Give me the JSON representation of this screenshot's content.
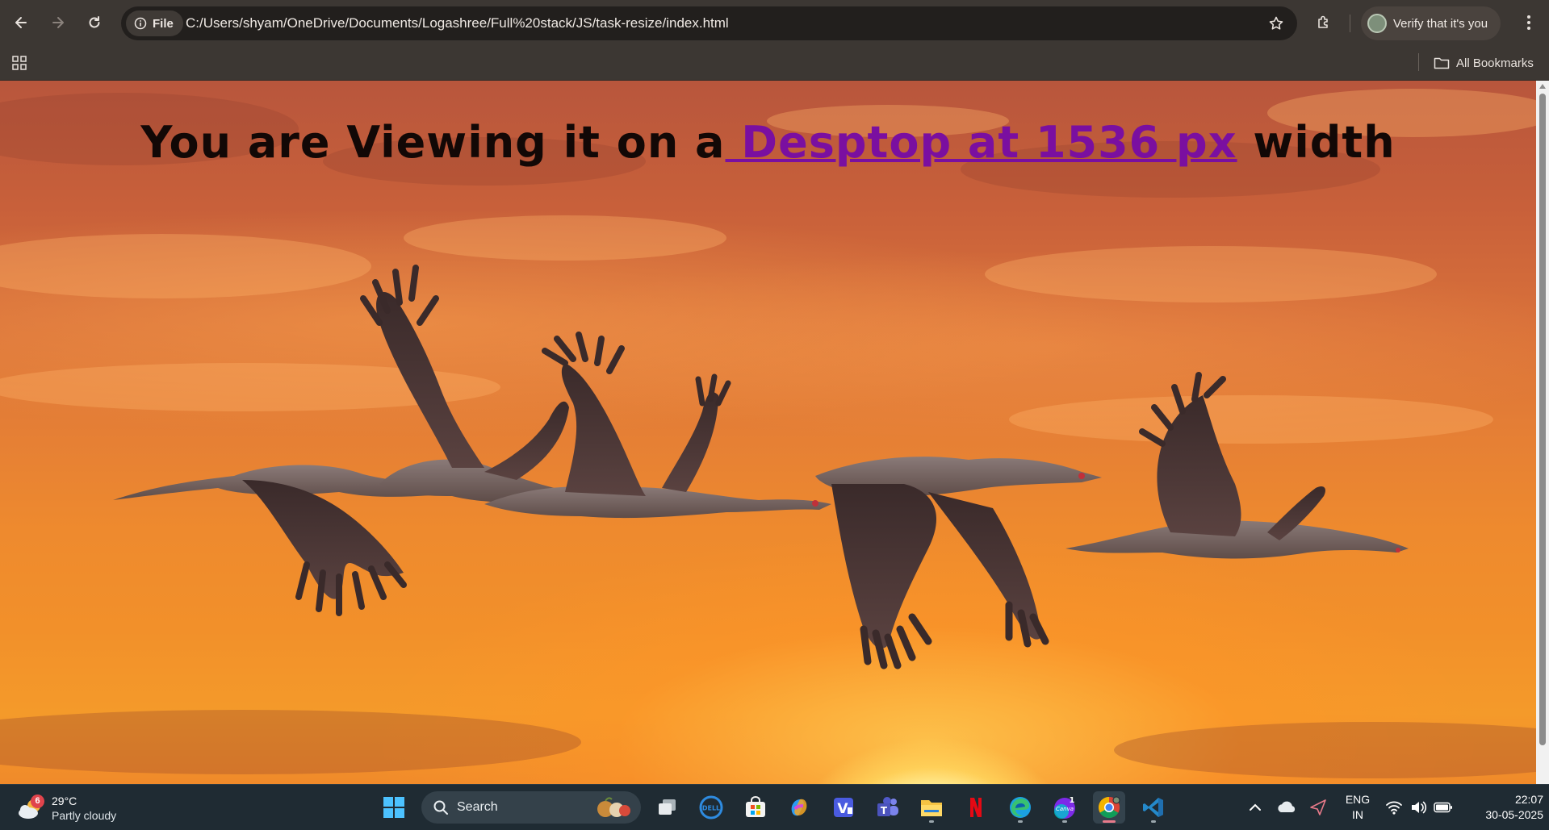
{
  "browser": {
    "url": "C:/Users/shyam/OneDrive/Documents/Logashree/Full%20stack/JS/task-resize/index.html",
    "file_chip_label": "File",
    "profile_label": "Verify that it's you",
    "bookmarks_label": "All Bookmarks",
    "icons": [
      "back-arrow-icon",
      "forward-arrow-icon",
      "reload-icon",
      "info-icon",
      "star-icon",
      "extensions-icon",
      "kebab-menu-icon",
      "apps-grid-icon",
      "folder-icon"
    ]
  },
  "page": {
    "heading_before": "You are Viewing it on a",
    "heading_link": " Desptop at 1536 px",
    "heading_after": " width",
    "link_color": "#7a0fa0",
    "background": "sunset sky with five flying cranes"
  },
  "taskbar": {
    "weather_temp": "29°C",
    "weather_desc": "Partly cloudy",
    "weather_badge": "6",
    "search_label": "Search",
    "apps": [
      {
        "name": "start"
      },
      {
        "name": "task-view"
      },
      {
        "name": "dell"
      },
      {
        "name": "microsoft-store"
      },
      {
        "name": "copilot"
      },
      {
        "name": "vivaldi-v"
      },
      {
        "name": "teams"
      },
      {
        "name": "file-explorer"
      },
      {
        "name": "netflix"
      },
      {
        "name": "edge"
      },
      {
        "name": "canva",
        "badge": "1"
      },
      {
        "name": "chrome"
      },
      {
        "name": "vscode"
      }
    ],
    "lang_line1": "ENG",
    "lang_line2": "IN",
    "time": "22:07",
    "date": "30-05-2025",
    "accent_active": "#e87a8a"
  }
}
